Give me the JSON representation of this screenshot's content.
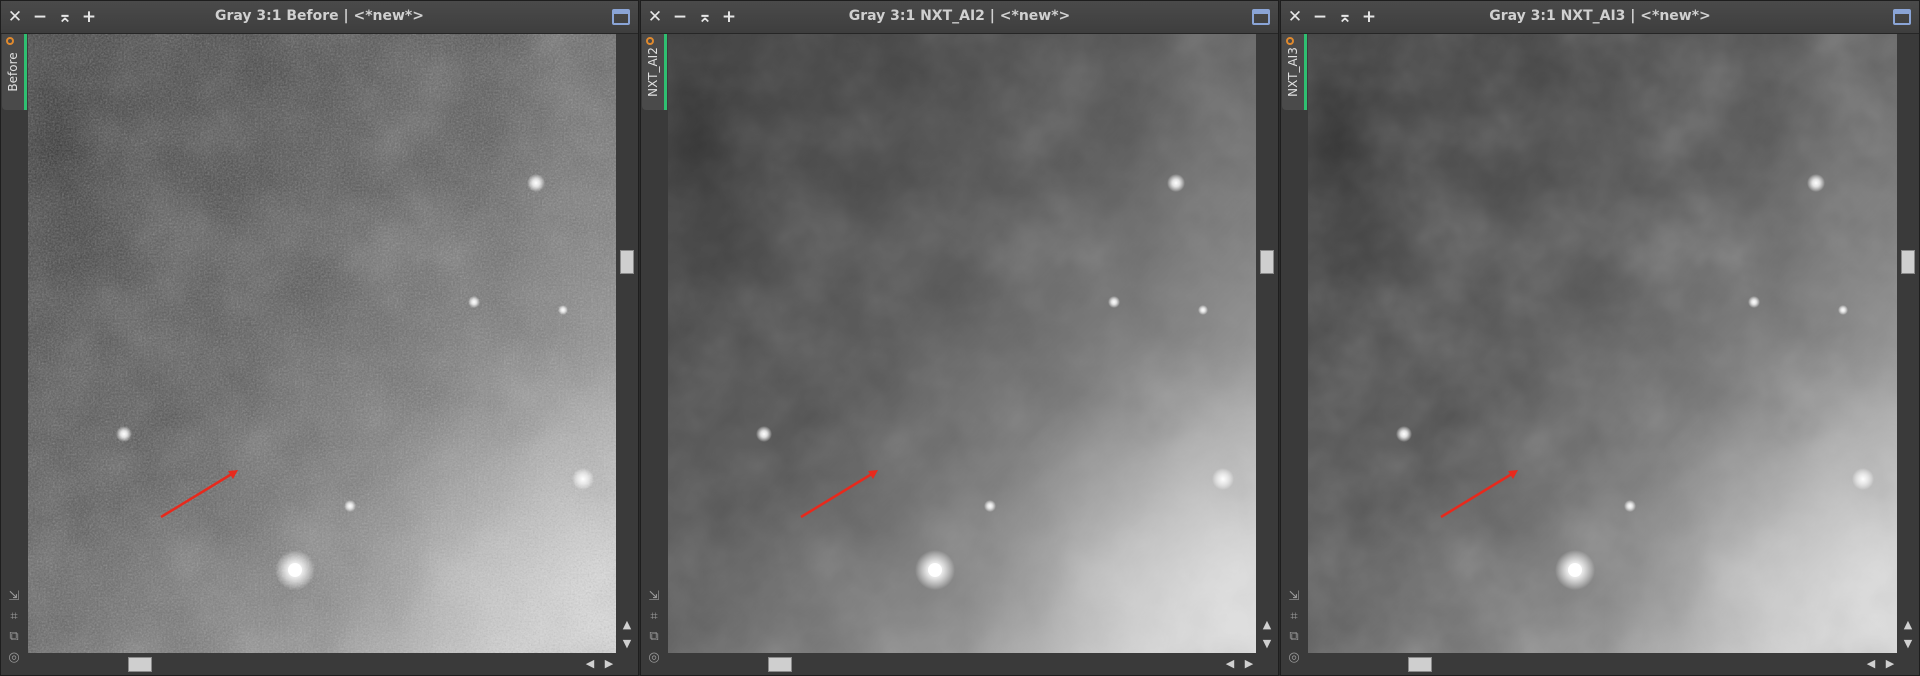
{
  "windows": [
    {
      "title": "Gray 3:1 Before | <*new*>",
      "tab_label": "Before"
    },
    {
      "title": "Gray 3:1 NXT_AI2 | <*new*>",
      "tab_label": "NXT_AI2"
    },
    {
      "title": "Gray 3:1 NXT_AI3 | <*new*>",
      "tab_label": "NXT_AI3"
    }
  ],
  "icons": {
    "close": "close-icon",
    "minimize": "minimize-icon",
    "shade": "shade-icon",
    "add": "plus-icon",
    "maximize": "maximize-icon",
    "zoom_fit": "zoom-fit-icon",
    "zoom_actual": "zoom-actual-icon",
    "clone": "clone-view-icon",
    "target": "target-icon"
  },
  "colors": {
    "accent_tab": "#2fbf71",
    "orange_dot": "#e08a2e",
    "arrow": "#e8291c"
  }
}
